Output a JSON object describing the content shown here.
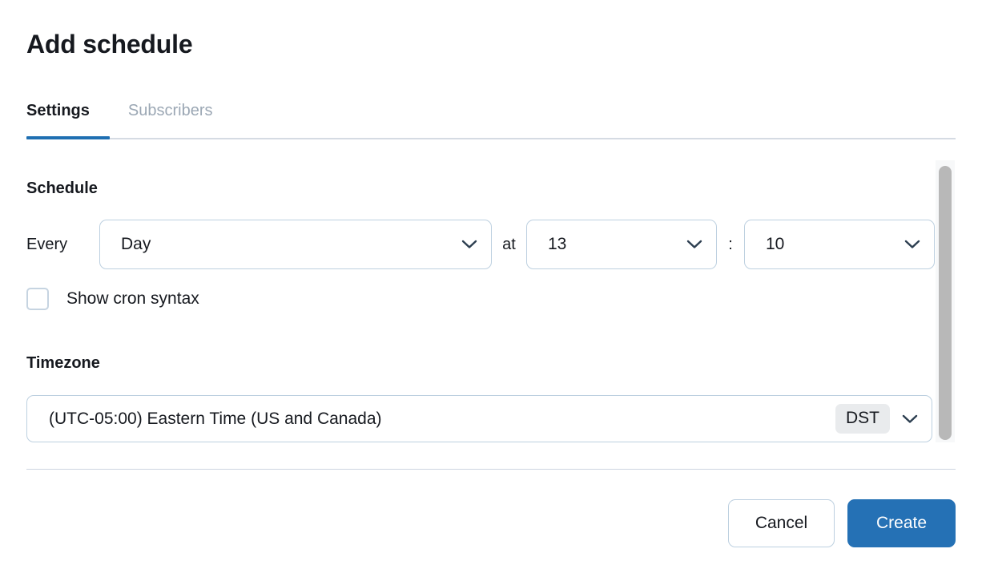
{
  "dialog": {
    "title": "Add schedule"
  },
  "tabs": [
    {
      "id": "settings",
      "label": "Settings",
      "active": true
    },
    {
      "id": "subscribers",
      "label": "Subscribers",
      "active": false
    }
  ],
  "schedule": {
    "heading": "Schedule",
    "every_label": "Every",
    "at_label": "at",
    "colon_label": ":",
    "frequency": {
      "value": "Day",
      "icon": "chevron-down-icon"
    },
    "hour": {
      "value": "13",
      "icon": "chevron-down-icon"
    },
    "minute": {
      "value": "10",
      "icon": "chevron-down-icon"
    },
    "cron": {
      "label": "Show cron syntax",
      "checked": false
    }
  },
  "timezone": {
    "heading": "Timezone",
    "value": "(UTC-05:00) Eastern Time (US and Canada)",
    "badge": "DST",
    "icon": "chevron-down-icon"
  },
  "footer": {
    "cancel_label": "Cancel",
    "create_label": "Create"
  },
  "colors": {
    "accent": "#1f6fb2",
    "primary_button": "#2571b5",
    "text": "#16191f",
    "muted_text": "#9ba7b4",
    "border": "#bdd0e0",
    "divider": "#ccd5e0",
    "badge_bg": "#e9ebed",
    "scrollbar_thumb": "#b8b8b8"
  }
}
